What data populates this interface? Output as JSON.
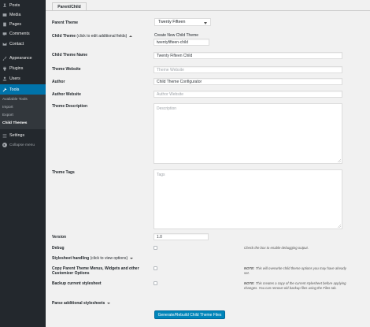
{
  "sidebar": {
    "items": [
      {
        "label": "Posts",
        "icon": "pin-icon"
      },
      {
        "label": "Media",
        "icon": "media-icon"
      },
      {
        "label": "Pages",
        "icon": "pages-icon"
      },
      {
        "label": "Comments",
        "icon": "comments-icon"
      },
      {
        "label": "Contact",
        "icon": "mail-icon"
      },
      {
        "label": "Appearance",
        "icon": "paintbrush-icon"
      },
      {
        "label": "Plugins",
        "icon": "plugins-icon"
      },
      {
        "label": "Users",
        "icon": "users-icon"
      },
      {
        "label": "Tools",
        "icon": "tools-icon"
      },
      {
        "label": "Settings",
        "icon": "settings-icon"
      }
    ],
    "submenu": [
      "Available Tools",
      "Import",
      "Export",
      "Child Themes"
    ],
    "collapse_label": "Collapse menu",
    "active_color": "#0073aa"
  },
  "tab": {
    "label": "Parent/Child"
  },
  "form": {
    "parent_theme_label": "Parent Theme",
    "parent_theme_value": "Twenty Fifteen",
    "child_theme_label": "Child Theme",
    "child_theme_hint": "(click to edit additional fields)",
    "create_new_label": "Create New Child Theme",
    "create_new_value": "twentyfifteen-child",
    "theme_name_label": "Child Theme Name",
    "theme_name_value": "Twenty Fifteen Child",
    "theme_website_label": "Theme Website",
    "theme_website_placeholder": "Theme Website",
    "author_label": "Author",
    "author_value": "Child Theme Configurator",
    "author_website_label": "Author Website",
    "author_website_placeholder": "Author Website",
    "description_label": "Theme Description",
    "description_placeholder": "Description",
    "tags_label": "Theme Tags",
    "tags_placeholder": "Tags",
    "version_label": "Version",
    "version_value": "1.0",
    "debug_label": "Debug",
    "debug_note": "Check the box to enable debugging output.",
    "stylesheet_label": "Stylesheet handling",
    "stylesheet_hint": "(click to view options)",
    "copy_label": "Copy Parent Theme Menus, Widgets and other Customizer Options",
    "copy_note_bold": "NOTE:",
    "copy_note": "This will overwrite child theme options you may have already set.",
    "backup_label": "Backup current stylesheet",
    "backup_note_bold": "NOTE:",
    "backup_note": "This creates a copy of the current stylesheet before applying changes. You can remove old backup files using the Files tab.",
    "parse_label": "Parse additional stylesheets",
    "submit_label": "Generate/Rebuild Child Theme Files",
    "button_color": "#0085ba"
  }
}
